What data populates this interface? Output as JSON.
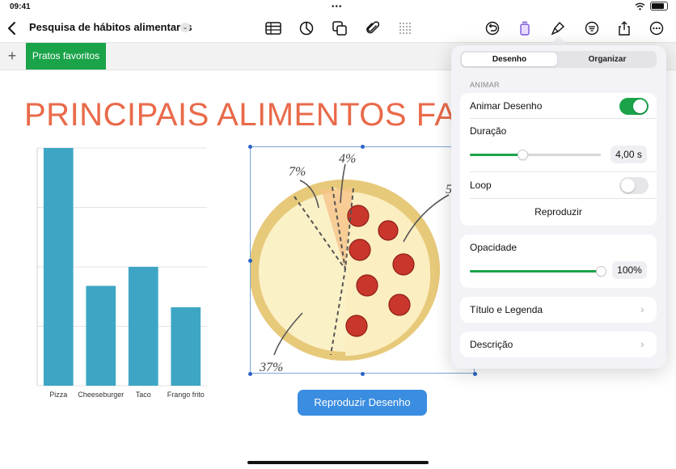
{
  "status": {
    "time": "09:41",
    "dots": "•••"
  },
  "toolbar": {
    "title": "Pesquisa de hábitos alimentares",
    "chevron": "⌄",
    "icons": [
      "back-icon",
      "table-icon",
      "chart-icon",
      "shapes-icon",
      "attachment-icon",
      "grid-icon",
      "undo-icon",
      "format-icon",
      "brush-icon",
      "filter-icon",
      "share-icon",
      "more-icon"
    ]
  },
  "sheet": {
    "add": "+",
    "tab": "Pratos favoritos"
  },
  "canvas": {
    "title": "PRINCIPAIS ALIMENTOS FAVO",
    "play_button": "Reproduzir Desenho"
  },
  "chart_data": {
    "type": "bar",
    "categories": [
      "Pizza",
      "Cheeseburger",
      "Taco",
      "Frango frito"
    ],
    "values": [
      100,
      42,
      50,
      33
    ],
    "ylim": [
      0,
      100
    ],
    "grid": true,
    "color": "#3ea6c4"
  },
  "drawing": {
    "labels": [
      "7%",
      "4%",
      "37%",
      "5"
    ]
  },
  "popover": {
    "tabs": [
      "Desenho",
      "Organizar"
    ],
    "section": "ANIMAR",
    "animate_label": "Animar Desenho",
    "animate_on": true,
    "duration_label": "Duração",
    "duration_value": "4,00 s",
    "duration_fraction": 0.4,
    "loop_label": "Loop",
    "loop_on": false,
    "play_label": "Reproduzir",
    "opacity_label": "Opacidade",
    "opacity_value": "100%",
    "opacity_fraction": 1.0,
    "title_caption_label": "Título e Legenda",
    "description_label": "Descrição",
    "accent": "#1ba34a"
  }
}
